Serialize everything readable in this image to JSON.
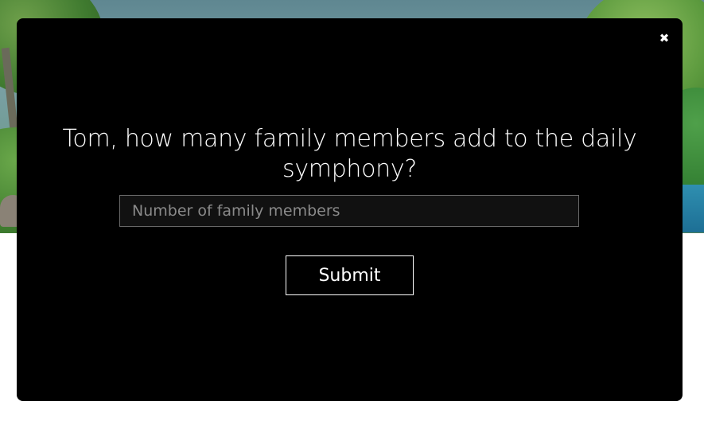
{
  "modal": {
    "close_icon": "close-icon",
    "close_glyph": "✖",
    "question": "Tom, how many family members add to the daily symphony?",
    "input": {
      "value": "",
      "placeholder": "Number of family members"
    },
    "submit_label": "Submit"
  },
  "colors": {
    "modal_background": "#000000",
    "text": "#ffffff",
    "input_border": "#6a6a6a",
    "placeholder": "#8a8a8a"
  }
}
